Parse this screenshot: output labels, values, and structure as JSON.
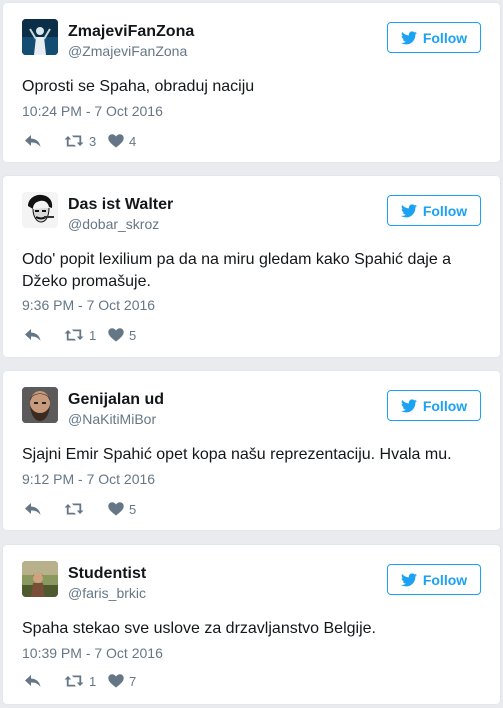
{
  "follow_label": "Follow",
  "colors": {
    "accent": "#1da1f2",
    "muted": "#657786",
    "text": "#14171a"
  },
  "icons": {
    "follow": "twitter-bird-icon",
    "reply": "reply-icon",
    "retweet": "retweet-icon",
    "like": "heart-icon"
  },
  "tweets": [
    {
      "name": "ZmajeviFanZona",
      "handle": "@ZmajeviFanZona",
      "text": "Oprosti se Spaha, obraduj naciju",
      "time": "10:24 PM - 7 Oct 2016",
      "retweets": "3",
      "likes": "4"
    },
    {
      "name": "Das ist Walter",
      "handle": "@dobar_skroz",
      "text": "Odo' popit lexilium pa da na miru gledam kako Spahić daje a Džeko promašuje.",
      "time": "9:36 PM - 7 Oct 2016",
      "retweets": "1",
      "likes": "5"
    },
    {
      "name": "Genijalan ud",
      "handle": "@NaKitiMiBor",
      "text": "Sjajni Emir Spahić opet kopa našu reprezentaciju. Hvala mu.",
      "time": "9:12 PM - 7 Oct 2016",
      "retweets": "",
      "likes": "5"
    },
    {
      "name": "Studentist",
      "handle": "@faris_brkic",
      "text": "Spaha stekao sve uslove za drzavljanstvo Belgije.",
      "time": "10:39 PM - 7 Oct 2016",
      "retweets": "1",
      "likes": "7"
    }
  ]
}
